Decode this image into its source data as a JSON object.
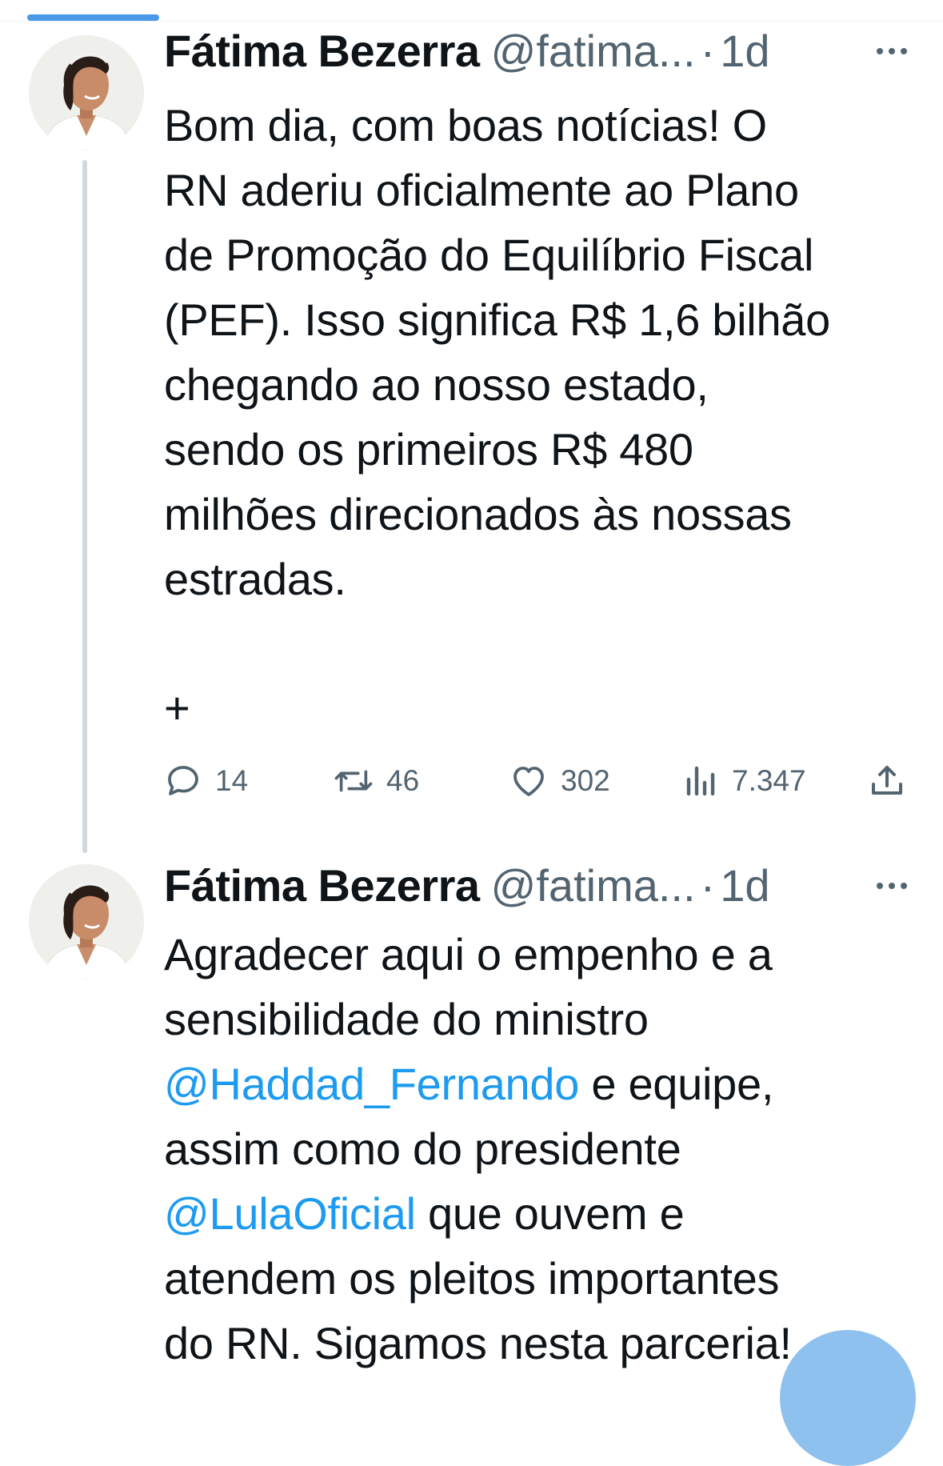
{
  "colors": {
    "accent": "#1d9bf0",
    "secondary_text": "#536471",
    "primary_text": "#0f1419",
    "thread_line": "#cfd9de",
    "compose_button": "#8fc1ee"
  },
  "tweets": [
    {
      "author_name": "Fátima Bezerra",
      "handle": "@fatima...",
      "separator": "·",
      "time": "1d",
      "text_lines": [
        "Bom dia, com boas notícias! O",
        "RN aderiu oficialmente ao Plano",
        "de Promoção do Equilíbrio Fiscal",
        "(PEF). Isso significa R$ 1,6 bilhão",
        "chegando ao nosso estado,",
        "sendo os primeiros R$ 480",
        "milhões direcionados às nossas",
        "estradas."
      ],
      "extra_symbol": "+",
      "actions": {
        "reply_icon": "reply-icon",
        "reply_count": "14",
        "retweet_icon": "retweet-icon",
        "retweet_count": "46",
        "like_icon": "heart-icon",
        "like_count": "302",
        "views_icon": "views-chart-icon",
        "views_count": "7.347",
        "share_icon": "share-icon"
      }
    },
    {
      "author_name": "Fátima Bezerra",
      "handle": "@fatima...",
      "separator": "·",
      "time": "1d",
      "lines": [
        {
          "text": "Agradecer aqui o empenho e a"
        },
        {
          "text": "sensibilidade do ministro"
        },
        {
          "mention": "@Haddad_Fernando",
          "text": " e equipe,"
        },
        {
          "text": "assim como do presidente"
        },
        {
          "mention": "@LulaOficial",
          "text": " que ouvem e"
        },
        {
          "text": "atendem os pleitos importantes"
        },
        {
          "text": "do RN. Sigamos nesta parceria!"
        }
      ]
    }
  ],
  "icons": {
    "more": "more-horizontal-icon",
    "compose": "compose-button"
  }
}
